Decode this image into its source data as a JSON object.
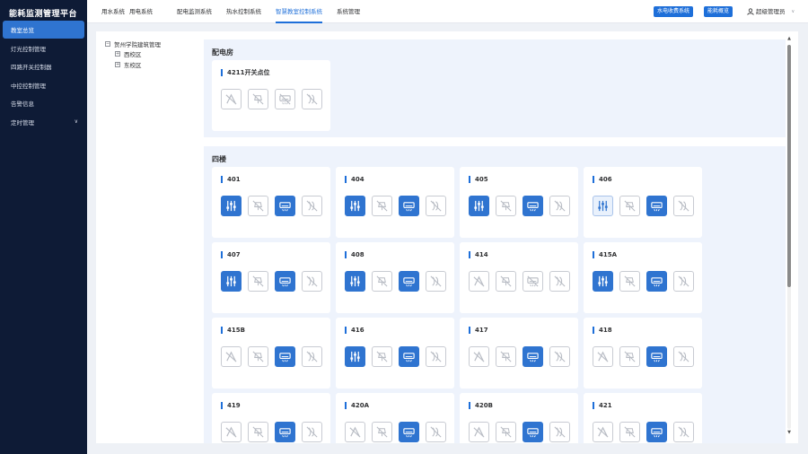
{
  "app": {
    "title": "能耗监测管理平台"
  },
  "sidebar": {
    "items": [
      {
        "label": "教室总览",
        "active": true
      },
      {
        "label": "灯光控制管理"
      },
      {
        "label": "四路开关控制器"
      },
      {
        "label": "中控控制管理"
      },
      {
        "label": "告警信息"
      },
      {
        "label": "定时管理",
        "has_children": true
      }
    ]
  },
  "topnav": {
    "tabs": [
      {
        "label": "用水系统"
      },
      {
        "label": "用电系统"
      },
      {
        "label": "配电监测系统"
      },
      {
        "label": "热水控制系统"
      },
      {
        "label": "智慧教室控制系统",
        "active": true
      },
      {
        "label": "系统管理"
      }
    ],
    "buttons": [
      {
        "label": "水电收费系统"
      },
      {
        "label": "能耗概览"
      }
    ],
    "user": "超级管理员"
  },
  "tree": {
    "root": "贺州学院建筑管理",
    "children": [
      "西校区",
      "东校区"
    ]
  },
  "colors": {
    "accent": "#2f74d0",
    "sidebar_bg": "#0e1b36"
  },
  "sections": [
    {
      "title": "配电房",
      "rooms": [
        {
          "name": "4211开关点位",
          "states": [
            "off",
            "off",
            "off",
            "off"
          ]
        }
      ]
    },
    {
      "title": "四楼",
      "rooms": [
        {
          "name": "401",
          "states": [
            "on",
            "off",
            "on",
            "off"
          ]
        },
        {
          "name": "404",
          "states": [
            "on",
            "off",
            "on",
            "off"
          ]
        },
        {
          "name": "405",
          "states": [
            "on",
            "off",
            "on",
            "off"
          ]
        },
        {
          "name": "406",
          "states": [
            "light",
            "off",
            "on",
            "off"
          ]
        },
        {
          "name": "407",
          "states": [
            "on",
            "off",
            "on",
            "off"
          ]
        },
        {
          "name": "408",
          "states": [
            "on",
            "off",
            "on",
            "off"
          ]
        },
        {
          "name": "414",
          "states": [
            "off",
            "off",
            "off",
            "off"
          ]
        },
        {
          "name": "415A",
          "states": [
            "on",
            "off",
            "on",
            "off"
          ]
        },
        {
          "name": "415B",
          "states": [
            "off",
            "off",
            "on",
            "off"
          ]
        },
        {
          "name": "416",
          "states": [
            "on",
            "off",
            "on",
            "off"
          ]
        },
        {
          "name": "417",
          "states": [
            "off",
            "off",
            "on",
            "off"
          ]
        },
        {
          "name": "418",
          "states": [
            "off",
            "off",
            "on",
            "off"
          ]
        },
        {
          "name": "419",
          "states": [
            "off",
            "off",
            "on",
            "off"
          ]
        },
        {
          "name": "420A",
          "states": [
            "off",
            "off",
            "on",
            "off"
          ]
        },
        {
          "name": "420B",
          "states": [
            "off",
            "off",
            "on",
            "off"
          ]
        },
        {
          "name": "421",
          "states": [
            "off",
            "off",
            "on",
            "off"
          ]
        }
      ]
    }
  ]
}
